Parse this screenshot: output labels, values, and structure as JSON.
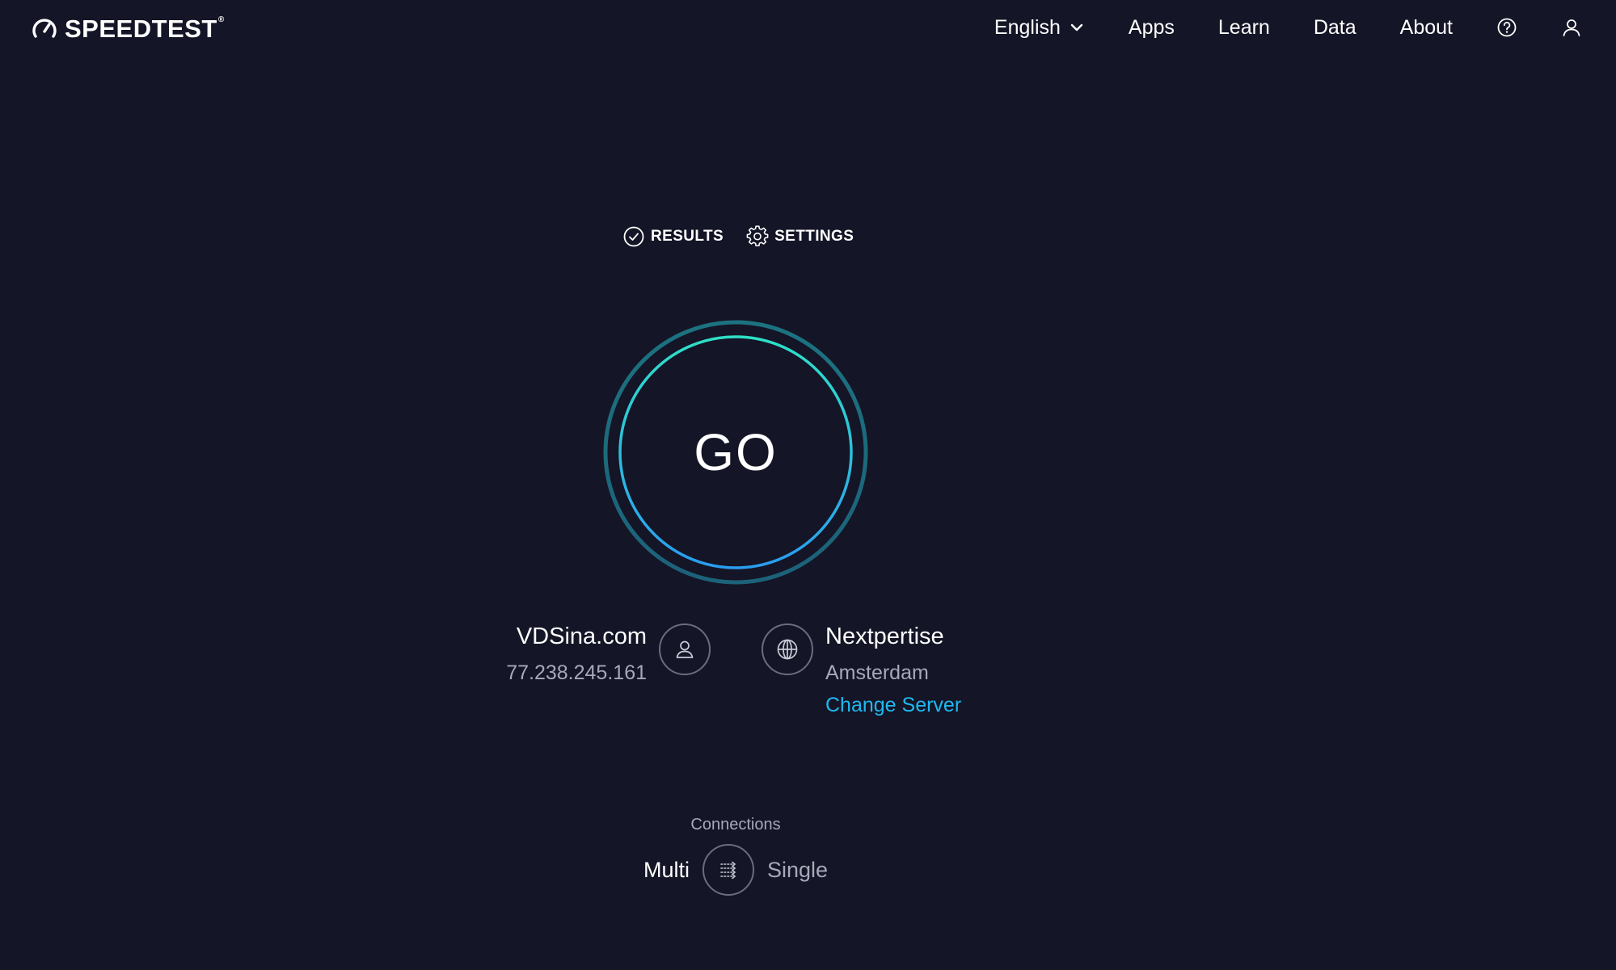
{
  "header": {
    "logo_text": "SPEEDTEST",
    "logo_tm": "®",
    "nav": {
      "language": "English",
      "apps": "Apps",
      "learn": "Learn",
      "data": "Data",
      "about": "About"
    },
    "icons": {
      "help": "help-circle-icon",
      "account": "user-icon",
      "language_dropdown": "chevron-down-icon"
    }
  },
  "links": {
    "results": "RESULTS",
    "settings": "SETTINGS"
  },
  "go_button": {
    "label": "GO"
  },
  "isp": {
    "name": "VDSina.com",
    "ip": "77.238.245.161"
  },
  "server": {
    "name": "Nextpertise",
    "location": "Amsterdam",
    "change_label": "Change Server"
  },
  "connections": {
    "label": "Connections",
    "multi": "Multi",
    "single": "Single",
    "selected": "Multi"
  },
  "colors": {
    "background": "#141526",
    "ring_outer": "#1f7b8c",
    "ring_inner_top": "#2ee0c8",
    "ring_inner_bottom": "#2a9df0",
    "link_accent": "#1fb8f0",
    "muted_text": "#a7a9b8"
  }
}
